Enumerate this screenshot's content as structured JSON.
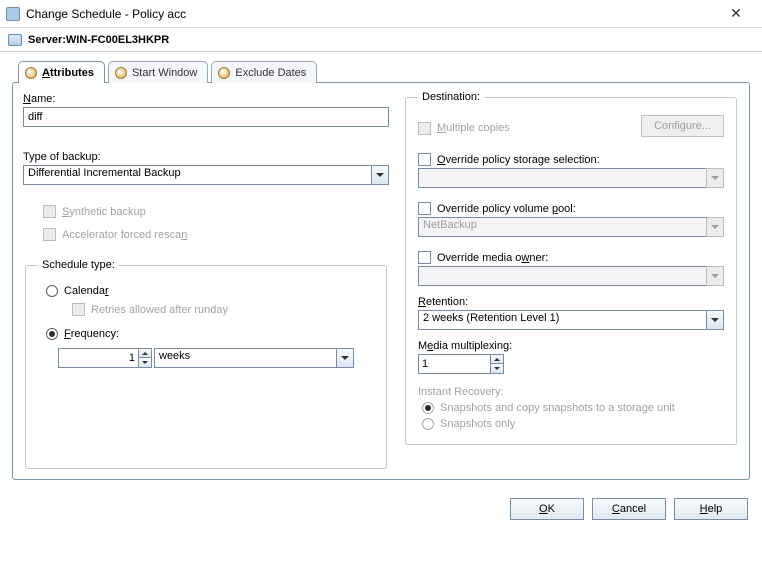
{
  "window": {
    "title": "Change Schedule - Policy acc"
  },
  "server": {
    "label": "Server: ",
    "name": "WIN-FC00EL3HKPR"
  },
  "tabs": {
    "attributes": "Attributes",
    "start_window": "Start Window",
    "exclude_dates": "Exclude Dates"
  },
  "left": {
    "name_label": "Name:",
    "name_value": "diff",
    "type_label": "Type of backup:",
    "type_value": "Differential Incremental Backup",
    "synthetic": "Synthetic backup",
    "accel": "Accelerator forced rescan",
    "schedule_type_legend": "Schedule type:",
    "calendar": "Calendar",
    "retries": "Retries allowed after runday",
    "frequency": "Frequency:",
    "freq_value": "1",
    "freq_unit": "weeks"
  },
  "right": {
    "destination_legend": "Destination:",
    "multiple_copies": "Multiple copies",
    "configure": "Configure...",
    "override_storage": "Override policy storage selection:",
    "storage_value": "",
    "override_volume": "Override policy volume pool:",
    "volume_value": "NetBackup",
    "override_media_owner": "Override media owner:",
    "media_owner_value": "",
    "retention_label": "Retention:",
    "retention_value": "2 weeks (Retention Level 1)",
    "media_mpx_label": "Media multiplexing:",
    "media_mpx_value": "1",
    "instant_recovery_label": "Instant Recovery:",
    "ir_opt1": "Snapshots and copy snapshots to a storage unit",
    "ir_opt2": "Snapshots only"
  },
  "footer": {
    "ok": "OK",
    "cancel": "Cancel",
    "help": "Help"
  }
}
